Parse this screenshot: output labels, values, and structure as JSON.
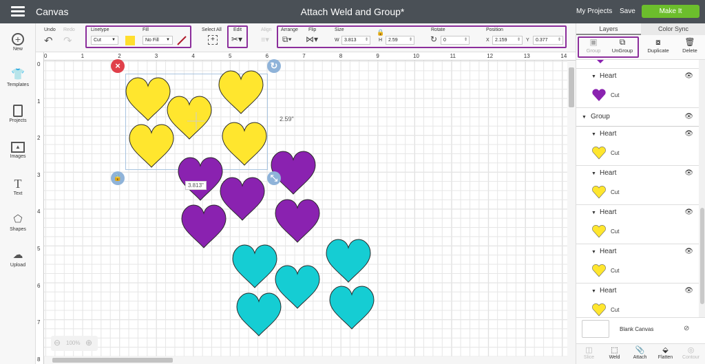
{
  "app": {
    "title": "Canvas",
    "doc_title": "Attach Weld and Group*",
    "my_projects": "My Projects",
    "save": "Save",
    "make_it": "Make It"
  },
  "toolbar": {
    "undo": "Undo",
    "redo": "Redo",
    "linetype_label": "Linetype",
    "linetype_value": "Cut",
    "fill_label": "Fill",
    "fill_value": "No Fill",
    "select_all": "Select All",
    "edit": "Edit",
    "align": "Align",
    "arrange": "Arrange",
    "flip": "Flip",
    "size": "Size",
    "w_label": "W",
    "w_value": "3.813",
    "h_label": "H",
    "h_value": "2.59",
    "rotate": "Rotate",
    "rotate_value": "0",
    "position": "Position",
    "x_label": "X",
    "x_value": "2.159",
    "y_label": "Y",
    "y_value": "0.377",
    "swatch_color": "#ffde2e"
  },
  "leftnav": [
    {
      "label": "New",
      "icon": "plus-circle-icon"
    },
    {
      "label": "Templates",
      "icon": "shirt-icon"
    },
    {
      "label": "Projects",
      "icon": "projects-icon"
    },
    {
      "label": "Images",
      "icon": "image-icon"
    },
    {
      "label": "Text",
      "icon": "text-icon"
    },
    {
      "label": "Shapes",
      "icon": "shapes-icon"
    },
    {
      "label": "Upload",
      "icon": "upload-icon"
    }
  ],
  "ruler": {
    "top": [
      "0",
      "1",
      "2",
      "3",
      "4",
      "5",
      "6",
      "7",
      "8",
      "9",
      "10",
      "11",
      "12",
      "13",
      "14"
    ],
    "left": [
      "0",
      "1",
      "2",
      "3",
      "4",
      "5",
      "6",
      "7",
      "8"
    ]
  },
  "canvas": {
    "dim_height": "2.59\"",
    "dim_width": "3.813\"",
    "zoom": "100%"
  },
  "colors": {
    "yellow": "#ffe62e",
    "purple": "#8a22b0",
    "teal": "#15cdd3",
    "accent": "#8b2d9b",
    "make_it": "#6cbe2c"
  },
  "panel": {
    "tab_layers": "Layers",
    "tab_color_sync": "Color Sync",
    "group": "Group",
    "ungroup": "UnGroup",
    "duplicate": "Duplicate",
    "delete": "Delete",
    "layers": [
      {
        "name": "Heart",
        "sub": "Cut",
        "color": "purple"
      },
      {
        "name": "Group",
        "sub": ""
      },
      {
        "name": "Heart",
        "sub": "Cut",
        "color": "yellow"
      },
      {
        "name": "Heart",
        "sub": "Cut",
        "color": "yellow"
      },
      {
        "name": "Heart",
        "sub": "Cut",
        "color": "yellow"
      },
      {
        "name": "Heart",
        "sub": "Cut",
        "color": "yellow"
      },
      {
        "name": "Heart",
        "sub": "Cut",
        "color": "yellow"
      }
    ],
    "blank_canvas": "Blank Canvas",
    "bottom": [
      "Slice",
      "Weld",
      "Attach",
      "Flatten",
      "Contour"
    ]
  }
}
